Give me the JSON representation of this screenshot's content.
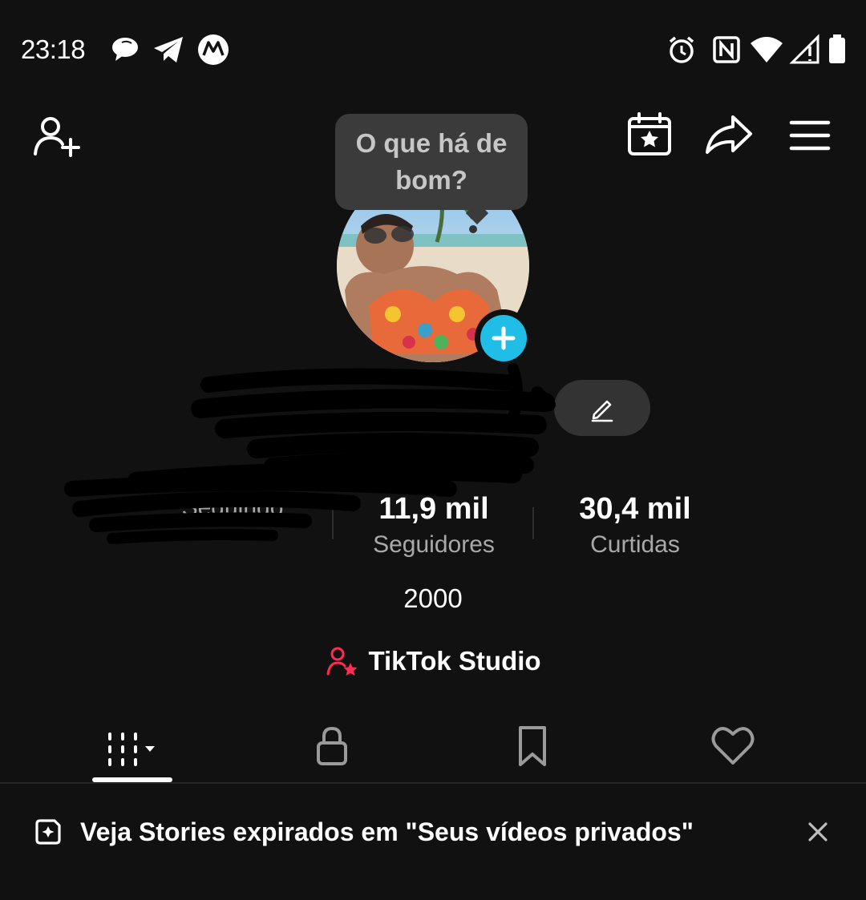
{
  "status_bar": {
    "time": "23:18",
    "left_icons": [
      "chat-bubble-icon",
      "telegram-icon",
      "motorola-icon"
    ],
    "right_icons": [
      "alarm-icon",
      "nfc-icon",
      "wifi-icon",
      "signal-icon",
      "battery-icon"
    ]
  },
  "header": {
    "left_icon": "add-user-icon",
    "right_icons": [
      "calendar-star-icon",
      "share-icon",
      "menu-icon"
    ]
  },
  "tooltip": {
    "text": "O que há de bom?"
  },
  "stats": [
    {
      "value": "",
      "label": "Seguindo"
    },
    {
      "value": "11,9 mil",
      "label": "Seguidores"
    },
    {
      "value": "30,4 mil",
      "label": "Curtidas"
    }
  ],
  "bio": "2000",
  "studio": {
    "label": "TikTok Studio",
    "accent_color": "#fe2c55"
  },
  "tabs": [
    {
      "icon": "grid-videos-icon",
      "active": true
    },
    {
      "icon": "lock-icon",
      "active": false
    },
    {
      "icon": "bookmark-icon",
      "active": false
    },
    {
      "icon": "heart-icon",
      "active": false
    }
  ],
  "banner": {
    "text": "Veja Stories expirados em \"Seus vídeos privados\""
  },
  "colors": {
    "background": "#111111",
    "avatar_add": "#20bde6"
  }
}
